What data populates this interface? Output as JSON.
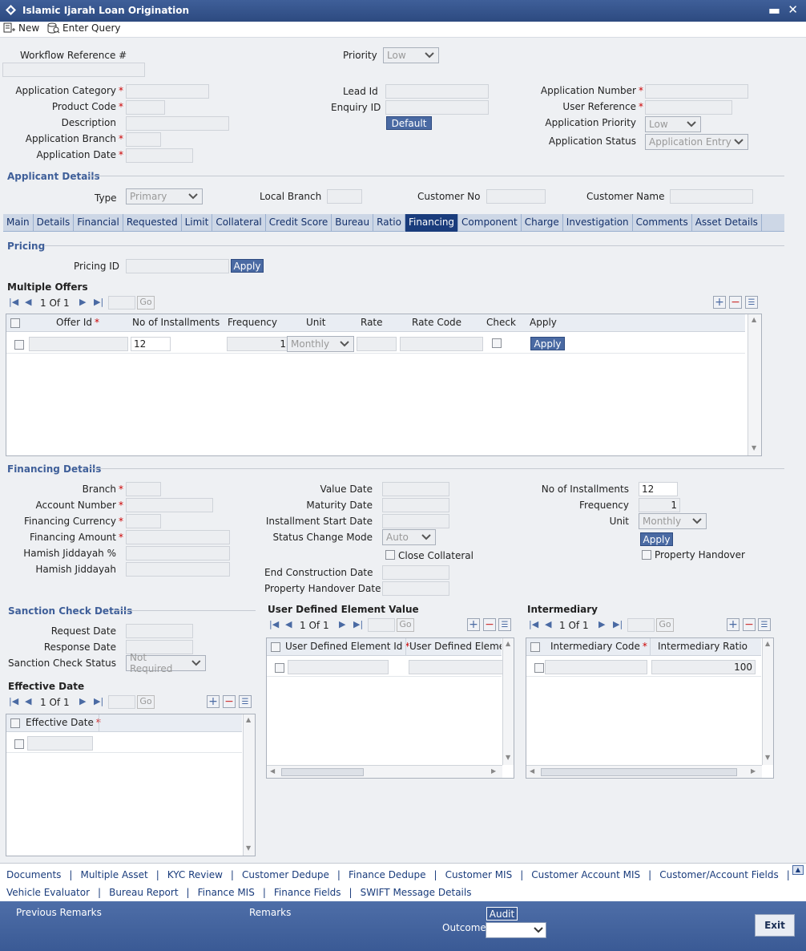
{
  "window": {
    "title": "Islamic Ijarah Loan Origination",
    "minimize": "▬",
    "close": "✕"
  },
  "toolbar": {
    "new_label": "New",
    "enter_query_label": "Enter Query"
  },
  "header": {
    "workflow_ref_label": "Workflow Reference #",
    "priority_label": "Priority",
    "priority_value": "Low",
    "app_category_label": "Application Category",
    "product_code_label": "Product Code",
    "description_label": "Description",
    "app_branch_label": "Application Branch",
    "app_date_label": "Application Date",
    "lead_id_label": "Lead Id",
    "enquiry_id_label": "Enquiry ID",
    "default_button": "Default",
    "app_number_label": "Application Number",
    "user_ref_label": "User Reference",
    "app_priority_label": "Application Priority",
    "app_priority_value": "Low",
    "app_status_label": "Application Status",
    "app_status_value": "Application Entry",
    "req": "*"
  },
  "applicant": {
    "section": "Applicant Details",
    "type_label": "Type",
    "type_value": "Primary",
    "local_branch_label": "Local Branch",
    "customer_no_label": "Customer No",
    "customer_name_label": "Customer Name"
  },
  "tabs": [
    "Main",
    "Details",
    "Financial",
    "Requested",
    "Limit",
    "Collateral",
    "Credit Score",
    "Bureau",
    "Ratio",
    "Financing",
    "Component",
    "Charge",
    "Investigation",
    "Comments",
    "Asset Details"
  ],
  "active_tab": "Financing",
  "pricing": {
    "section": "Pricing",
    "pricing_id_label": "Pricing ID",
    "apply_button": "Apply"
  },
  "offers": {
    "title": "Multiple Offers",
    "pager": {
      "page": "1",
      "of": "Of",
      "total": "1",
      "go": "Go"
    },
    "columns": [
      "Offer Id",
      "No of Installments",
      "Frequency",
      "Unit",
      "Rate",
      "Rate Code",
      "Check",
      "Apply"
    ],
    "row": {
      "installments": "12",
      "frequency": "1",
      "unit": "Monthly",
      "apply": "Apply"
    }
  },
  "financing": {
    "section": "Financing Details",
    "branch_label": "Branch",
    "account_label": "Account Number",
    "currency_label": "Financing Currency",
    "amount_label": "Financing Amount",
    "hamish_pct_label": "Hamish Jiddayah %",
    "hamish_label": "Hamish Jiddayah",
    "value_date_label": "Value Date",
    "maturity_label": "Maturity Date",
    "inst_start_label": "Installment Start Date",
    "status_change_label": "Status Change Mode",
    "status_change_value": "Auto",
    "close_collateral_label": "Close Collateral",
    "end_construction_label": "End Construction Date",
    "property_handover_date_label": "Property Handover Date",
    "no_inst_label": "No of Installments",
    "no_inst_value": "12",
    "frequency_label": "Frequency",
    "frequency_value": "1",
    "unit_label": "Unit",
    "unit_value": "Monthly",
    "apply_button": "Apply",
    "property_handover_label": "Property Handover"
  },
  "sanction": {
    "section": "Sanction Check Details",
    "request_label": "Request Date",
    "response_label": "Response Date",
    "status_label": "Sanction Check Status",
    "status_value": "Not Required"
  },
  "effective": {
    "title": "Effective Date",
    "pager": {
      "page": "1",
      "of": "Of",
      "total": "1",
      "go": "Go"
    },
    "column": "Effective Date"
  },
  "ude": {
    "title": "User Defined Element Value",
    "pager": {
      "page": "1",
      "of": "Of",
      "total": "1",
      "go": "Go"
    },
    "columns": [
      "User Defined Element Id",
      "User Defined Elemer"
    ]
  },
  "intermediary": {
    "title": "Intermediary",
    "pager": {
      "page": "1",
      "of": "Of",
      "total": "1",
      "go": "Go"
    },
    "columns": [
      "Intermediary Code",
      "Intermediary Ratio"
    ],
    "row": {
      "ratio": "100"
    }
  },
  "links": {
    "row1": [
      "Documents",
      "Multiple Asset",
      "KYC Review",
      "Customer Dedupe",
      "Finance Dedupe",
      "Customer MIS",
      "Customer Account MIS",
      "Customer/Account Fields"
    ],
    "row2": [
      "Vehicle Evaluator",
      "Bureau Report",
      "Finance MIS",
      "Finance Fields",
      "SWIFT Message Details"
    ],
    "sep": "|"
  },
  "footer": {
    "previous_remarks": "Previous Remarks",
    "remarks": "Remarks",
    "audit": "Audit",
    "outcome": "Outcome",
    "exit": "Exit"
  }
}
